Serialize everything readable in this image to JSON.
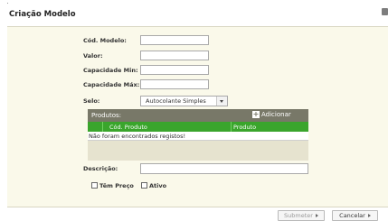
{
  "window": {
    "title": "Criação Modelo"
  },
  "form": {
    "cod_modelo_label": "Cód. Modelo:",
    "valor_label": "Valor:",
    "cap_min_label": "Capacidade Min:",
    "cap_max_label": "Capacidade Máx:",
    "selo_label": "Selo:",
    "selo_value": "Autocolante Simples",
    "descricao_label": "Descrição:",
    "tem_preco_label": "Têm Preço",
    "ativo_label": "Ativo"
  },
  "produtos": {
    "title": "Produtos:",
    "add_label": "Adicionar",
    "columns": [
      "Cód. Produto",
      "Produto"
    ],
    "empty_message": "Não foram encontrados registos!"
  },
  "footer": {
    "submit_label": "Submeter",
    "cancel_label": "Cancelar"
  }
}
